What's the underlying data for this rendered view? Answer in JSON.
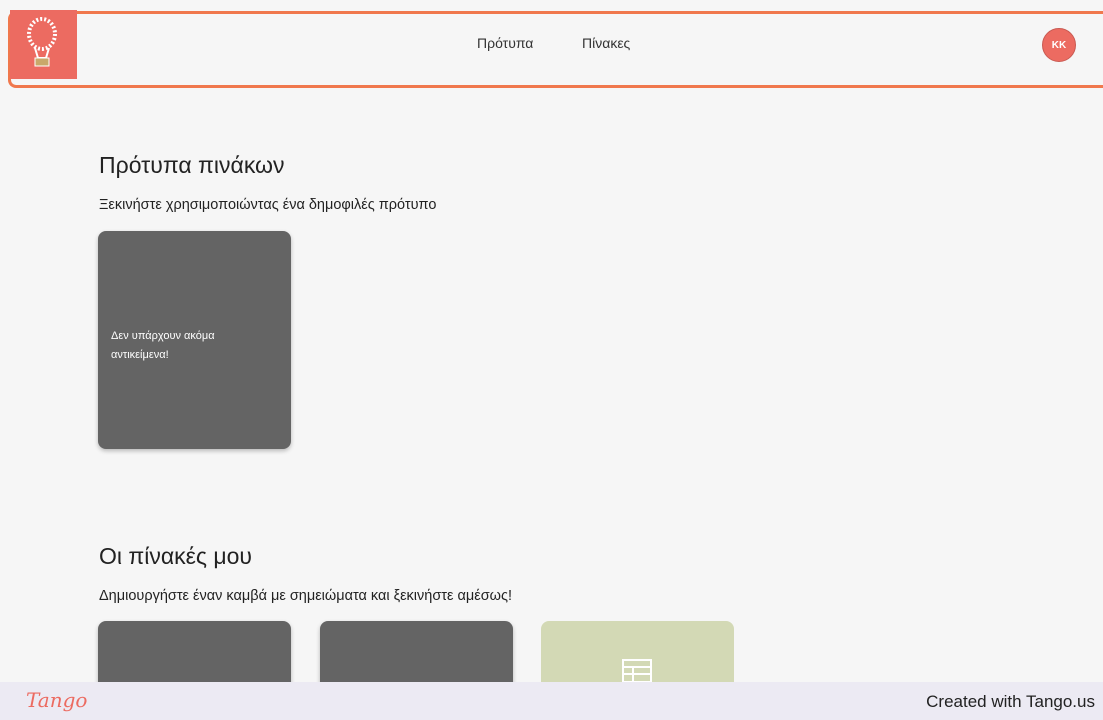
{
  "nav": {
    "templates_label": "Πρότυπα",
    "boards_label": "Πίνακες",
    "avatar_initials": "KK"
  },
  "templates_section": {
    "title": "Πρότυπα πινάκων",
    "subtitle": "Ξεκινήστε χρησιμοποιώντας ένα δημοφιλές πρότυπο",
    "empty_text": "Δεν υπάρχουν ακόμα αντικείμενα!"
  },
  "boards_section": {
    "title": "Οι πίνακές μου",
    "subtitle": "Δημιουργήστε έναν καμβά με σημειώματα και ξεκινήστε αμέσως!"
  },
  "footer": {
    "brand": "Tango",
    "credit": "Created with Tango.us"
  },
  "colors": {
    "accent": "#f0784d",
    "brand": "#ec6b61",
    "card": "#646464",
    "new_card": "#d3d9b5"
  }
}
